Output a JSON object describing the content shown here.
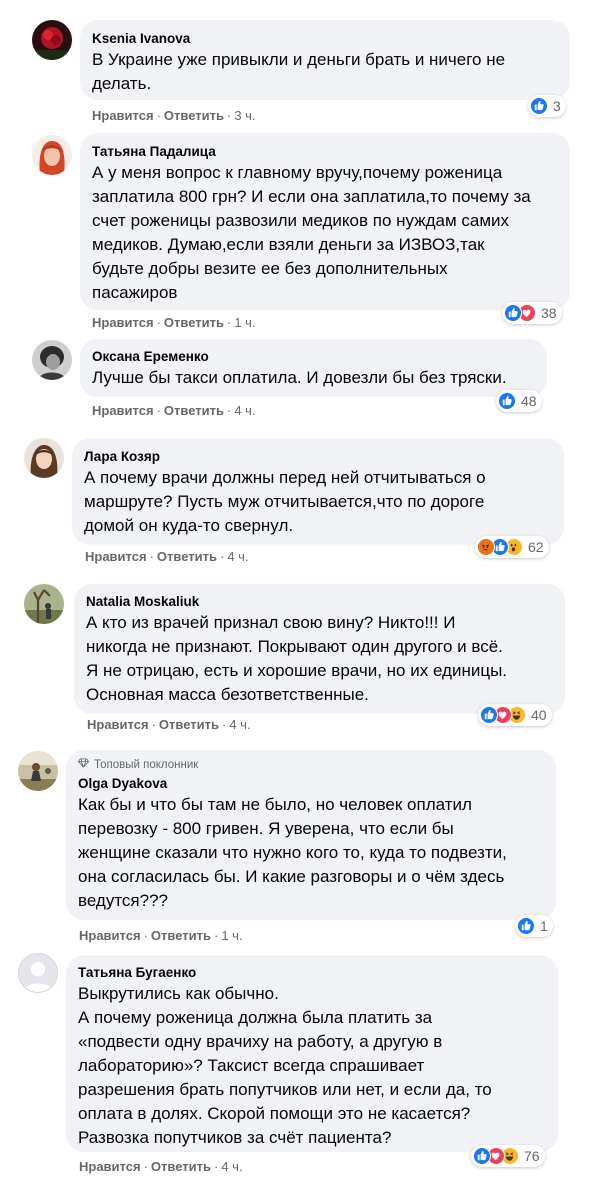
{
  "actions": {
    "like": "Нравится",
    "reply": "Ответить"
  },
  "comments": [
    {
      "author": "Ksenia Ivanova",
      "lines": [
        "В Украине уже привыкли и деньги брать и ничего не",
        "делать."
      ],
      "time": "3 ч.",
      "reaction_count": "3",
      "reaction_icons": [
        "like"
      ]
    },
    {
      "author": "Татьяна Падалица",
      "lines": [
        "А у меня вопрос к главному вручу,почему роженица",
        "заплатила 800 грн? И если она заплатила,то почему за",
        "счет роженицы развозили медиков по нуждам самих",
        "медиков. Думаю,если взяли деньги за ИЗВОЗ,так",
        "будьте добры везите ее без дополнительных",
        "пасажиров"
      ],
      "time": "1 ч.",
      "reaction_count": "38",
      "reaction_icons": [
        "like",
        "love"
      ]
    },
    {
      "author": "Оксана Еременко",
      "lines": [
        "Лучше бы такси оплатила. И довезли бы без тряски."
      ],
      "time": "4 ч.",
      "reaction_count": "48",
      "reaction_icons": [
        "like"
      ]
    },
    {
      "author": "Лара Козяр",
      "lines": [
        "А почему врачи должны перед ней отчитываться о",
        "маршруте? Пусть муж отчитывается,что по дороге",
        "домой он куда-то свернул."
      ],
      "time": "4 ч.",
      "reaction_count": "62",
      "reaction_icons": [
        "angry",
        "like",
        "wow"
      ]
    },
    {
      "author": "Natalia Moskaliuk",
      "lines": [
        "А кто из врачей признал свою вину? Никто!!! И",
        "никогда не признают. Покрывают один другого и всё.",
        "Я не отрицаю, есть и хорошие врачи, но их единицы.",
        "Основная масса безответственные."
      ],
      "time": "4 ч.",
      "reaction_count": "40",
      "reaction_icons": [
        "like",
        "love",
        "haha"
      ]
    },
    {
      "author": "Olga Dyakova",
      "badge": "Топовый поклонник",
      "lines": [
        "Как бы и что бы там не было, но человек оплатил",
        "перевозку - 800 гривен. Я уверена, что если бы",
        "женщине сказали что нужно кого то, куда то подвезти,",
        "она согласилась бы. И какие разговоры и о чём здесь",
        "ведутся???"
      ],
      "time": "1 ч.",
      "reaction_count": "1",
      "reaction_icons": [
        "like"
      ]
    },
    {
      "author": "Татьяна Бугаенко",
      "lines": [
        "Выкрутились как обычно.",
        "А почему роженица должна была платить за",
        "«подвести одну врачиху на работу, а другую в",
        "лабораторию»? Таксист всегда спрашивает",
        "разрешения брать попутчиков или нет, и если да, то",
        "оплата в долях. Скорой помощи это не касается?",
        "Развозка попутчиков за счёт пациента?"
      ],
      "time": "4 ч.",
      "reaction_count": "76",
      "reaction_icons": [
        "like",
        "love",
        "haha"
      ]
    }
  ],
  "colors": {
    "bubble": "#f0f2f5",
    "secondary_text": "#65676b",
    "like": "#1877f2",
    "love": "#f33e58",
    "haha": "#f7b928",
    "angry": "#e9710f"
  }
}
